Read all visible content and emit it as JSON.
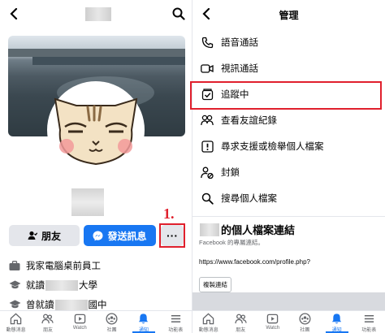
{
  "left": {
    "buttons": {
      "friends": "朋友",
      "message": "發送訊息",
      "more": "···"
    },
    "step_label": "1.",
    "intro": [
      {
        "icon": "briefcase-icon",
        "prefix": "我家電腦桌前員工",
        "suffix": ""
      },
      {
        "icon": "graduation-cap-icon",
        "prefix": "就讀",
        "suffix": "大學"
      },
      {
        "icon": "graduation-cap-icon",
        "prefix": "曾就讀",
        "suffix": "國中"
      }
    ]
  },
  "right": {
    "title": "管理",
    "menu": [
      {
        "icon": "phone-icon",
        "label": "語音通話"
      },
      {
        "icon": "video-camera-icon",
        "label": "視訊通話"
      },
      {
        "icon": "follow-check-icon",
        "label": "追蹤中"
      },
      {
        "icon": "friends-icon",
        "label": "查看友誼紀錄"
      },
      {
        "icon": "report-icon",
        "label": "尋求支援或檢舉個人檔案"
      },
      {
        "icon": "block-icon",
        "label": "封鎖"
      },
      {
        "icon": "search-icon",
        "label": "搜尋個人檔案"
      }
    ],
    "link_section": {
      "title": "的個人檔案連結",
      "subtitle": "Facebook 的專屬連結。",
      "url": "https://www.facebook.com/profile.php?",
      "copy_button": "複製連結"
    }
  },
  "tabbar": {
    "tabs": [
      {
        "icon": "home-icon",
        "label": "動態消息"
      },
      {
        "icon": "friends-icon",
        "label": "朋友"
      },
      {
        "icon": "watch-icon",
        "label": "Watch"
      },
      {
        "icon": "groups-icon",
        "label": "社團"
      },
      {
        "icon": "bell-icon",
        "label": "通知"
      },
      {
        "icon": "menu-icon",
        "label": "功能表"
      }
    ],
    "active_index": 4
  },
  "colors": {
    "accent": "#1877f2",
    "highlight": "#e0202d"
  }
}
